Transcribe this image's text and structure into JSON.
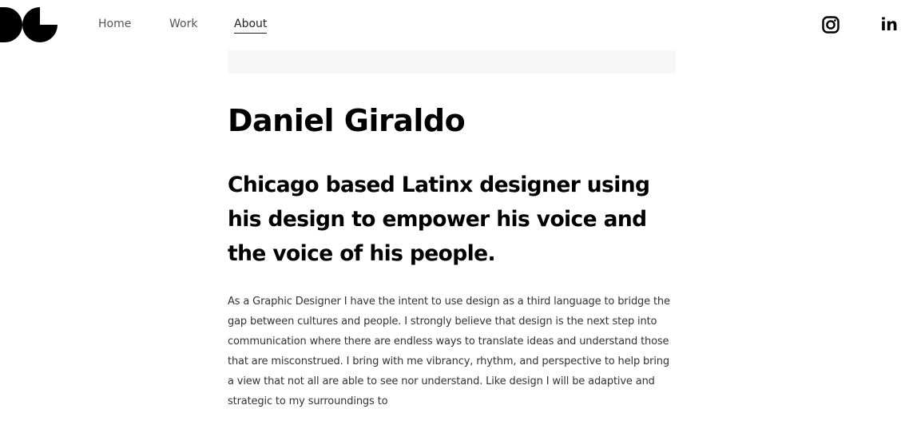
{
  "brand": {
    "logo_icon": "dg-monogram-logo"
  },
  "nav": {
    "items": [
      {
        "label": "Home",
        "active": false
      },
      {
        "label": "Work",
        "active": false
      },
      {
        "label": "About",
        "active": true
      }
    ]
  },
  "social": {
    "instagram_icon": "instagram-icon",
    "linkedin_label": "in"
  },
  "about": {
    "name": "Daniel Giraldo",
    "tagline": "Chicago based Latinx designer using his design to empower his voice and the voice of his people.",
    "bio": "As a Graphic Designer I have the intent to use design as a third language to bridge the gap between cultures and people. I strongly believe that design is the next step into communication where there are endless ways to translate ideas and understand those that are misconstrued. I bring with me vibrancy, rhythm, and perspective to help bring a view that not all are able to see nor understand. Like design I will be adaptive and strategic to my surroundings to"
  }
}
